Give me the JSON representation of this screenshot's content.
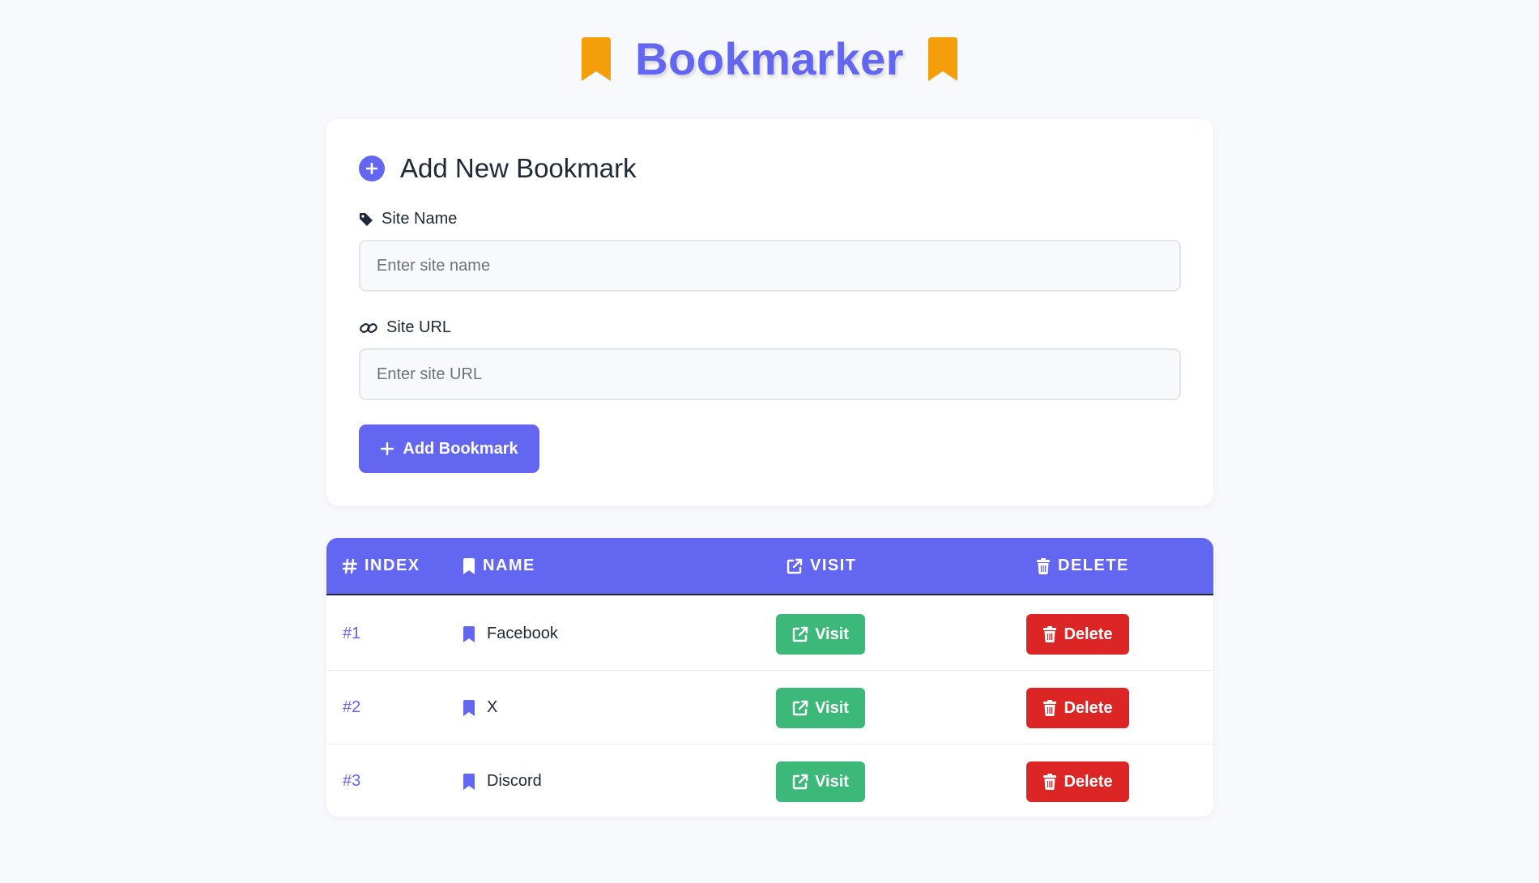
{
  "app": {
    "title": "Bookmarker",
    "ribbon_icon": "bookmark-ribbon-icon",
    "ribbon_color": "#f59e0b",
    "accent_color": "#6366f1"
  },
  "form": {
    "title": "Add New Bookmark",
    "title_icon": "plus-circle-icon",
    "name_label": "Site Name",
    "name_icon": "tag-icon",
    "name_placeholder": "Enter site name",
    "name_value": "",
    "url_label": "Site URL",
    "url_icon": "link-icon",
    "url_placeholder": "Enter site URL",
    "url_value": "",
    "submit_label": "Add Bookmark",
    "submit_icon": "plus-icon"
  },
  "table": {
    "columns": [
      {
        "label": "INDEX",
        "icon": "hash-icon"
      },
      {
        "label": "NAME",
        "icon": "bookmark-icon"
      },
      {
        "label": "VISIT",
        "icon": "external-link-icon"
      },
      {
        "label": "DELETE",
        "icon": "trash-icon"
      }
    ],
    "rows": [
      {
        "index": "#1",
        "name": "Facebook",
        "visit_label": "Visit",
        "delete_label": "Delete"
      },
      {
        "index": "#2",
        "name": "X",
        "visit_label": "Visit",
        "delete_label": "Delete"
      },
      {
        "index": "#3",
        "name": "Discord",
        "visit_label": "Visit",
        "delete_label": "Delete"
      }
    ],
    "visit_color": "#3cb878",
    "delete_color": "#dc2626"
  }
}
